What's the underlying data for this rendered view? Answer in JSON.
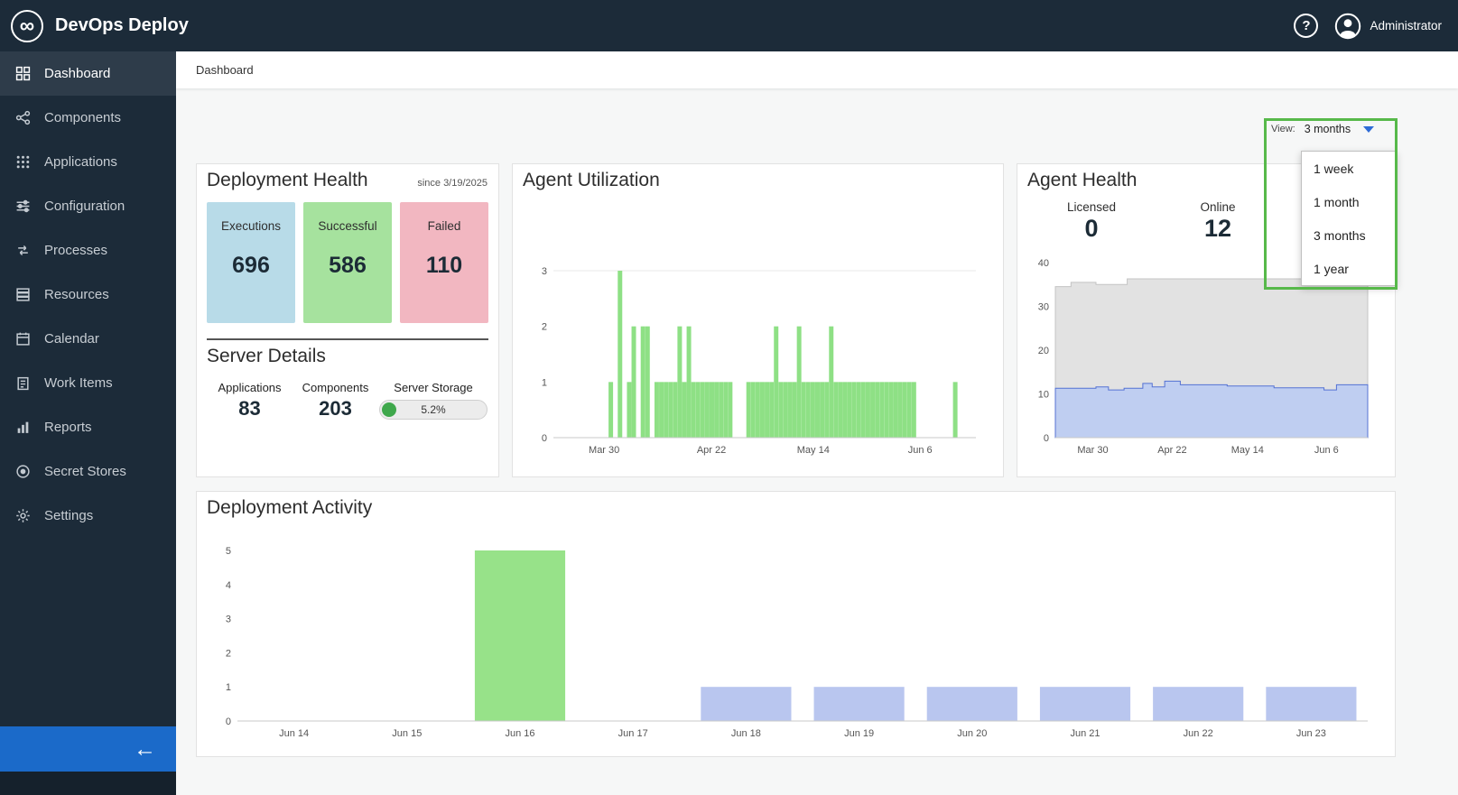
{
  "icons": {
    "logo_glyph": "∞",
    "help_glyph": "?",
    "collapse_glyph": "←"
  },
  "header": {
    "app_title": "DevOps Deploy",
    "user_name": "Administrator"
  },
  "sidebar": {
    "items": [
      {
        "label": "Dashboard",
        "icon": "dashboard-icon",
        "active": true
      },
      {
        "label": "Components",
        "icon": "components-icon",
        "active": false
      },
      {
        "label": "Applications",
        "icon": "applications-icon",
        "active": false
      },
      {
        "label": "Configuration",
        "icon": "configuration-icon",
        "active": false
      },
      {
        "label": "Processes",
        "icon": "processes-icon",
        "active": false
      },
      {
        "label": "Resources",
        "icon": "resources-icon",
        "active": false
      },
      {
        "label": "Calendar",
        "icon": "calendar-icon",
        "active": false
      },
      {
        "label": "Work Items",
        "icon": "work-items-icon",
        "active": false
      },
      {
        "label": "Reports",
        "icon": "reports-icon",
        "active": false
      },
      {
        "label": "Secret Stores",
        "icon": "secret-stores-icon",
        "active": false
      },
      {
        "label": "Settings",
        "icon": "settings-icon",
        "active": false
      }
    ]
  },
  "breadcrumb": "Dashboard",
  "view_selector": {
    "label": "View:",
    "selected": "3 months",
    "options": [
      "1 week",
      "1 month",
      "3 months",
      "1 year"
    ],
    "caret_color": "#2e6bd6"
  },
  "annotation": {
    "color": "#57b94a"
  },
  "deployment_health": {
    "title": "Deployment Health",
    "since": "since 3/19/2025",
    "stats": [
      {
        "label": "Executions",
        "value": "696",
        "bg": "#b8dbe8"
      },
      {
        "label": "Successful",
        "value": "586",
        "bg": "#a6e29e"
      },
      {
        "label": "Failed",
        "value": "110",
        "bg": "#f2b7c1"
      }
    ],
    "server_details": {
      "title": "Server Details",
      "metrics": [
        {
          "label": "Applications",
          "value": "83"
        },
        {
          "label": "Components",
          "value": "203"
        }
      ],
      "storage": {
        "label": "Server Storage",
        "value": "5.2%",
        "percent": 5.2,
        "fill_color": "#3fa84c"
      }
    }
  },
  "agent_utilization": {
    "title": "Agent Utilization"
  },
  "agent_health": {
    "title": "Agent Health",
    "stats": [
      {
        "label": "Licensed",
        "value": "0"
      },
      {
        "label": "Online",
        "value": "12"
      }
    ]
  },
  "deployment_activity": {
    "title": "Deployment Activity"
  },
  "chart_data": [
    {
      "id": "agent-utilization",
      "type": "bar",
      "title": "Agent Utilization",
      "ylim": [
        0,
        3
      ],
      "yticks": [
        0,
        1,
        2,
        3
      ],
      "xticks": [
        {
          "label": "Mar 30",
          "frac": 0.12
        },
        {
          "label": "Apr 22",
          "frac": 0.374
        },
        {
          "label": "May 14",
          "frac": 0.615
        },
        {
          "label": "Jun 6",
          "frac": 0.868
        }
      ],
      "bar_color": "#8ee085",
      "values": [
        0,
        0,
        0,
        0,
        0,
        0,
        0,
        0,
        0,
        0,
        0,
        0,
        1,
        0,
        3,
        0,
        1,
        2,
        0,
        2,
        2,
        0,
        1,
        1,
        1,
        1,
        1,
        2,
        1,
        2,
        1,
        1,
        1,
        1,
        1,
        1,
        1,
        1,
        1,
        0,
        0,
        0,
        1,
        1,
        1,
        1,
        1,
        1,
        2,
        1,
        1,
        1,
        1,
        2,
        1,
        1,
        1,
        1,
        1,
        1,
        2,
        1,
        1,
        1,
        1,
        1,
        1,
        1,
        1,
        1,
        1,
        1,
        1,
        1,
        1,
        1,
        1,
        1,
        1,
        0,
        0,
        0,
        0,
        0,
        0,
        0,
        0,
        1,
        0,
        0,
        0,
        0
      ]
    },
    {
      "id": "agent-health",
      "type": "area",
      "title": "Agent Health",
      "ylim": [
        0,
        40
      ],
      "yticks": [
        0,
        10,
        20,
        30,
        40
      ],
      "xticks": [
        {
          "label": "Mar 30",
          "frac": 0.12
        },
        {
          "label": "Apr 22",
          "frac": 0.374
        },
        {
          "label": "May 14",
          "frac": 0.615
        },
        {
          "label": "Jun 6",
          "frac": 0.868
        }
      ],
      "series": [
        {
          "name": "licensed-capacity",
          "fill": "#e2e2e2",
          "stroke": "#c4c4c4",
          "points": [
            [
              0,
              34.5
            ],
            [
              0.05,
              35.5
            ],
            [
              0.13,
              35.0
            ],
            [
              0.23,
              36.3
            ],
            [
              0.87,
              36.3
            ],
            [
              0.9,
              36.0
            ],
            [
              1,
              36.0
            ]
          ]
        },
        {
          "name": "online-agents",
          "fill": "#bfcef1",
          "stroke": "#5472d3",
          "points": [
            [
              0,
              11.3
            ],
            [
              0.13,
              11.6
            ],
            [
              0.17,
              10.9
            ],
            [
              0.22,
              11.3
            ],
            [
              0.28,
              12.4
            ],
            [
              0.31,
              11.6
            ],
            [
              0.35,
              12.9
            ],
            [
              0.4,
              12.1
            ],
            [
              0.55,
              11.8
            ],
            [
              0.7,
              11.4
            ],
            [
              0.86,
              10.9
            ],
            [
              0.9,
              12.1
            ],
            [
              1,
              11.8
            ]
          ]
        }
      ]
    },
    {
      "id": "deployment-activity",
      "type": "bar",
      "title": "Deployment Activity",
      "ylim": [
        0,
        5
      ],
      "yticks": [
        0,
        1,
        2,
        3,
        4,
        5
      ],
      "categories": [
        "Jun 14",
        "Jun 15",
        "Jun 16",
        "Jun 17",
        "Jun 18",
        "Jun 19",
        "Jun 20",
        "Jun 21",
        "Jun 22",
        "Jun 23"
      ],
      "values": [
        0,
        0,
        5,
        0,
        1,
        1,
        1,
        1,
        1,
        1
      ],
      "colors": [
        "#b9c6ef",
        "#b9c6ef",
        "#97e289",
        "#b9c6ef",
        "#b9c6ef",
        "#b9c6ef",
        "#b9c6ef",
        "#b9c6ef",
        "#b9c6ef",
        "#b9c6ef"
      ]
    }
  ]
}
